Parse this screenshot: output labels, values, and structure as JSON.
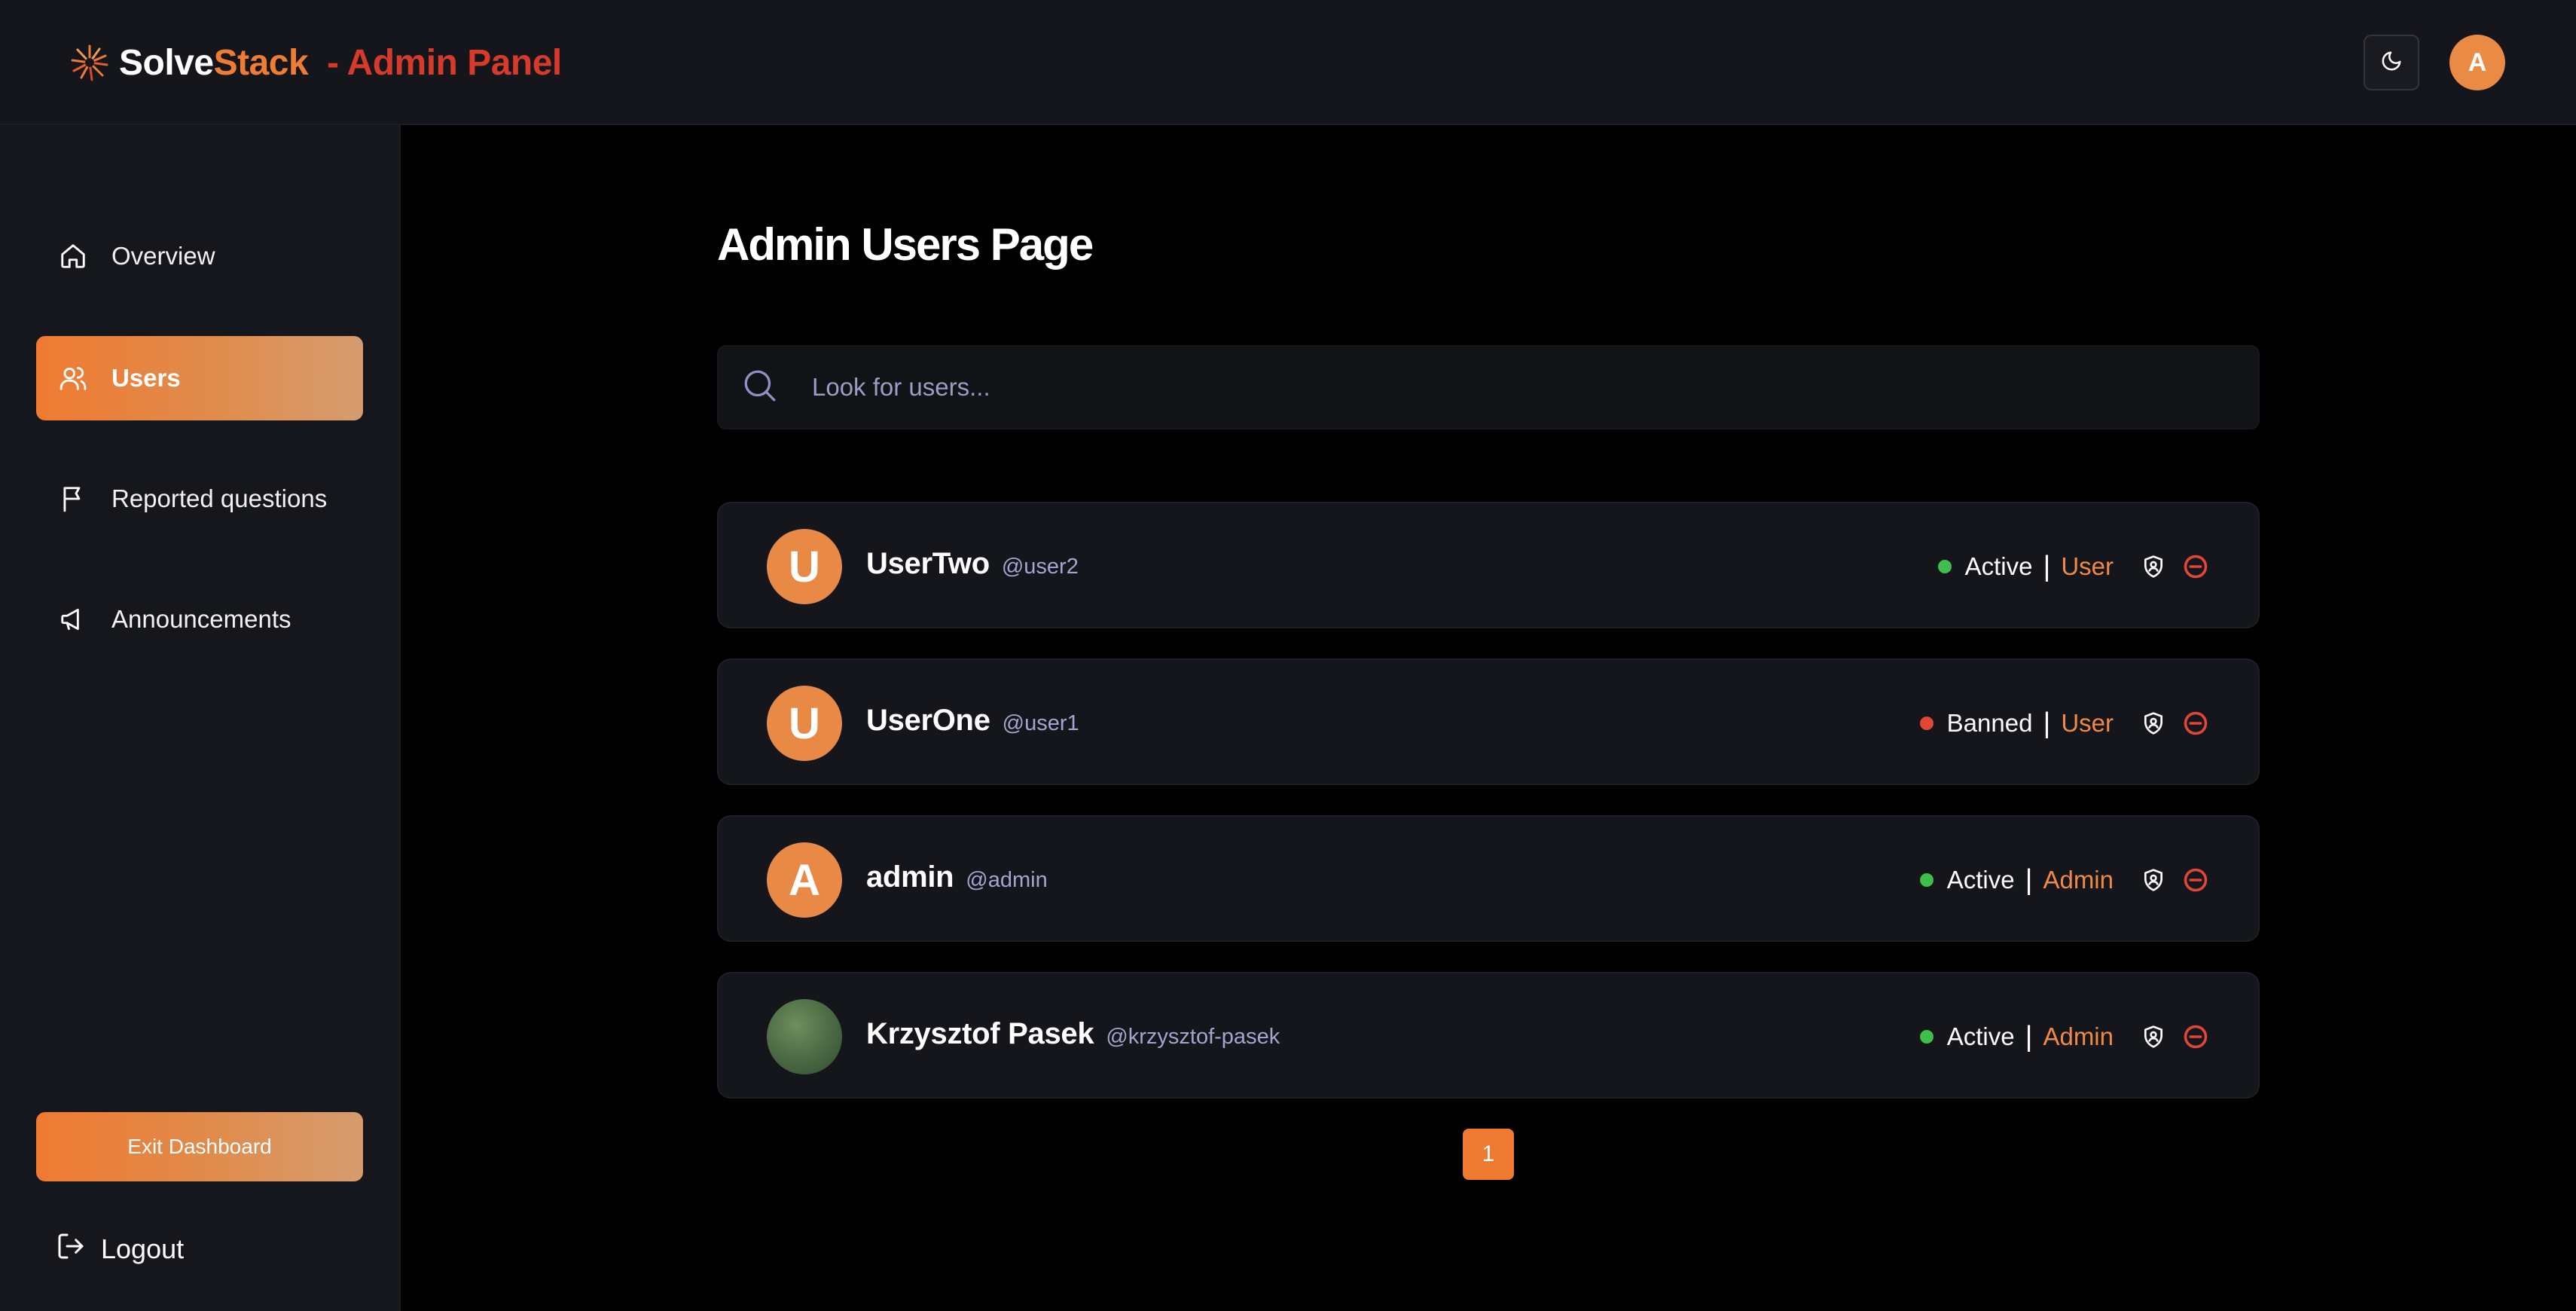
{
  "header": {
    "brand_solve": "Solve",
    "brand_stack": "Stack",
    "brand_separator": "-",
    "brand_panel": "Admin Panel",
    "avatar_letter": "A",
    "theme_icon": "moon-icon"
  },
  "sidebar": {
    "items": [
      {
        "label": "Overview",
        "icon": "home-icon",
        "active": false
      },
      {
        "label": "Users",
        "icon": "users-icon",
        "active": true
      },
      {
        "label": "Reported questions",
        "icon": "flag-icon",
        "active": false
      },
      {
        "label": "Announcements",
        "icon": "megaphone-icon",
        "active": false
      }
    ],
    "exit_label": "Exit Dashboard",
    "logout_label": "Logout"
  },
  "main": {
    "title": "Admin Users Page",
    "search": {
      "placeholder": "Look for users..."
    },
    "users": [
      {
        "name": "UserTwo",
        "handle": "@user2",
        "avatar": "U",
        "status": "Active",
        "role": "User"
      },
      {
        "name": "UserOne",
        "handle": "@user1",
        "avatar": "U",
        "status": "Banned",
        "role": "User"
      },
      {
        "name": "admin",
        "handle": "@admin",
        "avatar": "A",
        "status": "Active",
        "role": "Admin"
      },
      {
        "name": "Krzysztof Pasek",
        "handle": "@krzysztof-pasek",
        "avatar": "",
        "status": "Active",
        "role": "Admin"
      }
    ],
    "pagination": {
      "current": "1"
    }
  },
  "colors": {
    "accent": "#ef7a31",
    "active_status": "#3fbf4a",
    "banned_status": "#e0473a",
    "ban_icon": "#e0473a"
  },
  "separators": {
    "pipe": "|"
  }
}
